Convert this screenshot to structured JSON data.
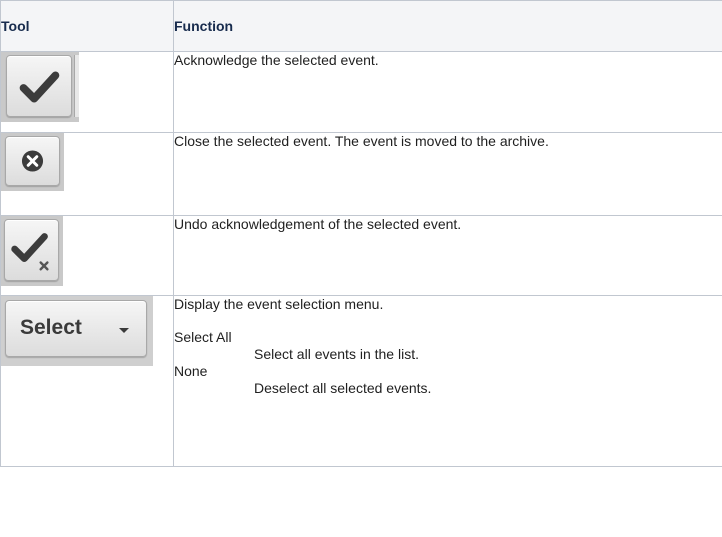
{
  "table": {
    "headers": {
      "tool": "Tool",
      "function": "Function"
    },
    "rows": [
      {
        "icon": "acknowledge-check-icon",
        "function": "Acknowledge the selected event."
      },
      {
        "icon": "close-x-circle-icon",
        "function": "Close the selected event. The event is moved to the archive."
      },
      {
        "icon": "undo-acknowledge-icon",
        "function": "Undo acknowledgement of the selected event."
      },
      {
        "icon": "select-dropdown-button",
        "button_label": "Select",
        "function": "Display the event selection menu.",
        "menu": [
          {
            "term": "Select All",
            "desc": "Select all events in the list."
          },
          {
            "term": "None",
            "desc": "Deselect all selected events."
          }
        ]
      }
    ]
  },
  "colors": {
    "border": "#c1c7d0",
    "header_bg": "#f4f5f7",
    "button_bg": "#e6e6e6",
    "icon_dark": "#3c3c3c"
  }
}
